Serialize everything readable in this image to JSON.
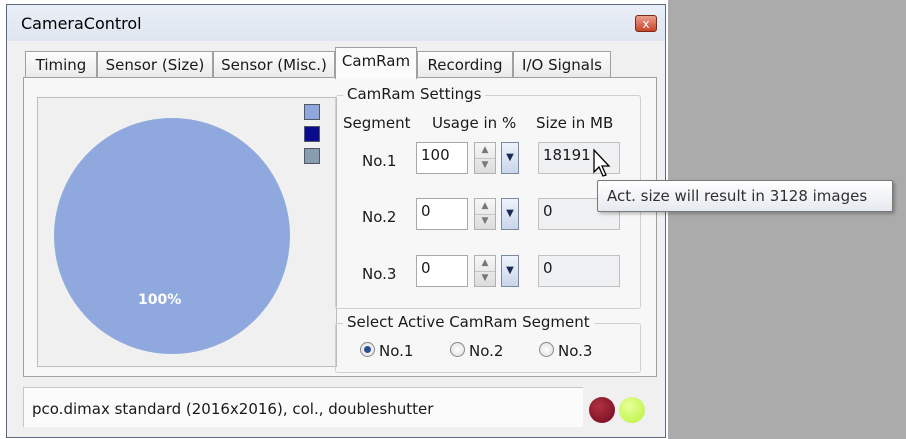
{
  "window": {
    "title": "CameraControl",
    "close_glyph": "x"
  },
  "tabs": [
    {
      "label": "Timing"
    },
    {
      "label": "Sensor (Size)"
    },
    {
      "label": "Sensor (Misc.)"
    },
    {
      "label": "CamRam"
    },
    {
      "label": "Recording"
    },
    {
      "label": "I/O Signals"
    }
  ],
  "active_tab": "CamRam",
  "camram_settings": {
    "group_title": "CamRam Settings",
    "headers": {
      "segment": "Segment",
      "usage": "Usage in %",
      "size": "Size in MB"
    },
    "segments": [
      {
        "label": "No.1",
        "usage": "100",
        "size": "18191"
      },
      {
        "label": "No.2",
        "usage": "0",
        "size": "0"
      },
      {
        "label": "No.3",
        "usage": "0",
        "size": "0"
      }
    ]
  },
  "active_segment": {
    "group_title": "Select Active CamRam Segment",
    "options": [
      "No.1",
      "No.2",
      "No.3"
    ],
    "selected": "No.1"
  },
  "pie": {
    "label": "100%",
    "colors": {
      "slice": "#8fa8de",
      "legend_1": "#8fa8de",
      "legend_2": "#0a0a8c",
      "legend_3": "#8a9cb0"
    }
  },
  "tooltip": {
    "text": "Act. size will result in 3128 images"
  },
  "status": {
    "text": "pco.dimax standard (2016x2016), col., doubleshutter",
    "leds": {
      "left": "#6e0a1e",
      "right": "#b6f23a"
    }
  },
  "icons": {
    "close": "close-icon",
    "spin": "spinner-arrows-icon",
    "dropdown": "chevron-down-icon",
    "cursor": "mouse-pointer-icon"
  }
}
